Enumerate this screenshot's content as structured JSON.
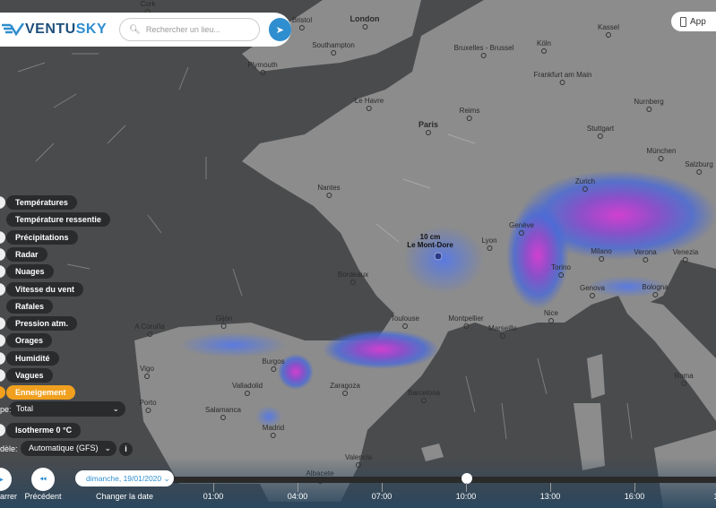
{
  "header": {
    "logo": "VENTUSKY",
    "logo_part1": "VENTU",
    "logo_part2": "SKY",
    "search_placeholder": "Rechercher un lieu...",
    "app_label": "App"
  },
  "layers": [
    {
      "label": "Températures",
      "active": false
    },
    {
      "label": "Température ressentie",
      "active": false
    },
    {
      "label": "Précipitations",
      "active": false
    },
    {
      "label": "Radar",
      "active": false
    },
    {
      "label": "Nuages",
      "active": false
    },
    {
      "label": "Vitesse du vent",
      "active": false
    },
    {
      "label": "Rafales",
      "active": false
    },
    {
      "label": "Pression atm.",
      "active": false
    },
    {
      "label": "Orages",
      "active": false
    },
    {
      "label": "Humidité",
      "active": false
    },
    {
      "label": "Vagues",
      "active": false
    },
    {
      "label": "Enneigement",
      "active": true
    }
  ],
  "type_label": "pe:",
  "type_value": "Total",
  "isotherm_label": "Isotherme 0 °C",
  "model_label": "dèle:",
  "model_value": "Automatique (GFS)",
  "snow_marker": {
    "value": "10 cm",
    "place": "Le Mont-Dore"
  },
  "timeline": {
    "play_label": "arrer",
    "prev_label": "Précédent",
    "date": "dimanche, 19/01/2020",
    "change_date": "Changer la date",
    "hours": [
      "01:00",
      "04:00",
      "07:00",
      "10:00",
      "13:00",
      "16:00",
      "1"
    ],
    "current": "10:00"
  },
  "map": {
    "cities": [
      "Cork",
      "Bristol",
      "London",
      "Southampton",
      "Plymouth",
      "Bruxelles - Brussel",
      "Köln",
      "Kassel",
      "Frankfurt am Main",
      "Le Havre",
      "Reims",
      "Paris",
      "Nurnberg",
      "Stuttgart",
      "München",
      "Salzburg",
      "Zurich",
      "Nantes",
      "Genève",
      "Lyon",
      "Milano",
      "Verona",
      "Venezia",
      "Torino",
      "Bordeaux",
      "Genova",
      "Bologna",
      "Nice",
      "Toulouse",
      "Montpellier",
      "Marseille",
      "A Coruña",
      "Gijón",
      "Burgos",
      "Vigo",
      "Valladolid",
      "Zaragoza",
      "Barcelona",
      "Roma",
      "Porto",
      "Salamanca",
      "Madrid",
      "Valencia",
      "Albacete"
    ]
  },
  "colors": {
    "accent": "#2f8ecf",
    "active": "#f0a01e",
    "sea": "#4a4b4d",
    "land": "#8c8c8c"
  }
}
